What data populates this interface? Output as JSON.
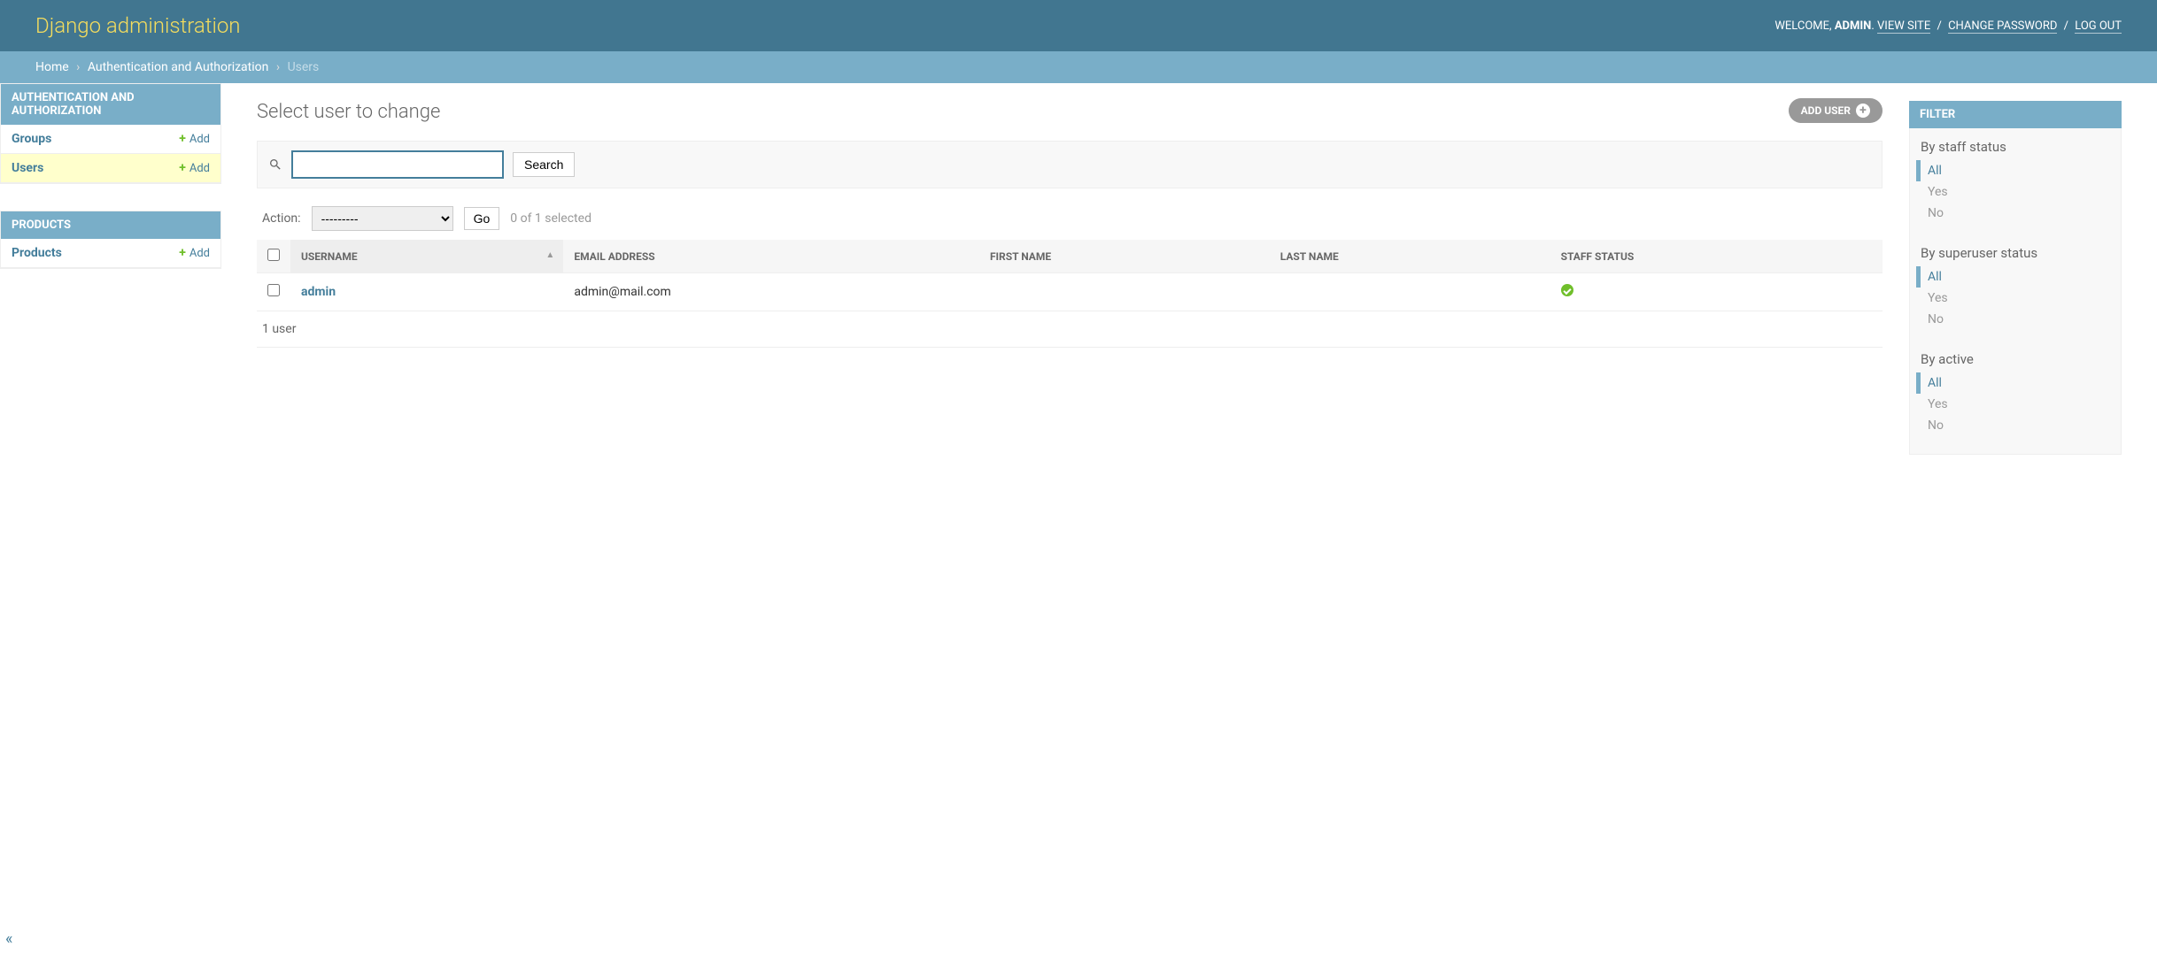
{
  "header": {
    "branding": "Django administration",
    "welcome": "WELCOME,",
    "username": "ADMIN",
    "view_site": "VIEW SITE",
    "change_password": "CHANGE PASSWORD",
    "log_out": "LOG OUT"
  },
  "breadcrumbs": {
    "home": "Home",
    "app": "Authentication and Authorization",
    "model": "Users"
  },
  "sidebar": {
    "sections": [
      {
        "caption": "AUTHENTICATION AND AUTHORIZATION",
        "items": [
          {
            "label": "Groups",
            "add": "Add",
            "active": false
          },
          {
            "label": "Users",
            "add": "Add",
            "active": true
          }
        ]
      },
      {
        "caption": "PRODUCTS",
        "items": [
          {
            "label": "Products",
            "add": "Add",
            "active": false
          }
        ]
      }
    ]
  },
  "main": {
    "page_title": "Select user to change",
    "add_button": "ADD USER",
    "search_button": "Search",
    "action_label": "Action:",
    "action_placeholder": "---------",
    "go_button": "Go",
    "selection_counter": "0 of 1 selected",
    "columns": {
      "username": "USERNAME",
      "email": "EMAIL ADDRESS",
      "first_name": "FIRST NAME",
      "last_name": "LAST NAME",
      "staff": "STAFF STATUS"
    },
    "rows": [
      {
        "username": "admin",
        "email": "admin@mail.com",
        "first_name": "",
        "last_name": "",
        "staff": true
      }
    ],
    "paginator": "1 user"
  },
  "filter": {
    "title": "FILTER",
    "groups": [
      {
        "title": "By staff status",
        "options": [
          "All",
          "Yes",
          "No"
        ],
        "selected": 0
      },
      {
        "title": "By superuser status",
        "options": [
          "All",
          "Yes",
          "No"
        ],
        "selected": 0
      },
      {
        "title": "By active",
        "options": [
          "All",
          "Yes",
          "No"
        ],
        "selected": 0
      }
    ]
  }
}
